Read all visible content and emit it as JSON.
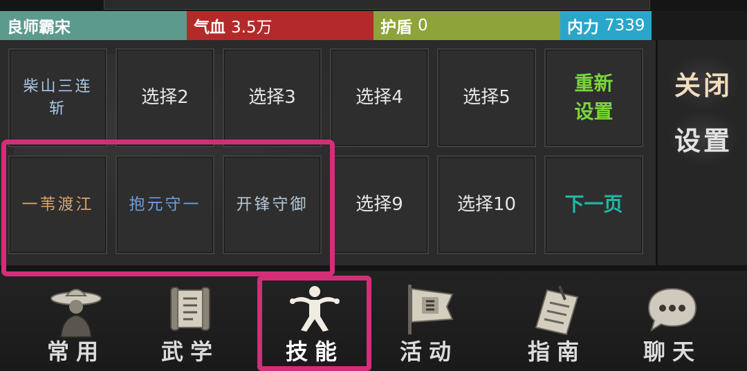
{
  "status": {
    "name": "良师霸宋",
    "hp_label": "气血",
    "hp_value": "3.5万",
    "shield_label": "护盾",
    "shield_value": "0",
    "mp_label": "内力",
    "mp_value": "7339"
  },
  "grid": {
    "row1": [
      "柴山三连斩",
      "选择2",
      "选择3",
      "选择4",
      "选择5",
      "重新设置"
    ],
    "row2": [
      "一苇渡江",
      "抱元守一",
      "开锋守御",
      "选择9",
      "选择10",
      "下一页"
    ]
  },
  "side": {
    "close": "关闭",
    "settings": "设置"
  },
  "nav": [
    "常用",
    "武学",
    "技能",
    "活动",
    "指南",
    "聊天"
  ],
  "icons": {
    "nav": [
      "hat-figure-icon",
      "scroll-icon",
      "martial-pose-icon",
      "flag-banner-icon",
      "guide-book-icon",
      "chat-bubble-icon"
    ]
  },
  "colors": {
    "name_bar": "#5c9a8e",
    "hp_bar": "#b42a2a",
    "shield_bar": "#8ea33a",
    "mp_bar": "#2ba6cb",
    "highlight": "#d42e78",
    "reset_text": "#7bd63c",
    "next_text": "#1fb8a8"
  }
}
